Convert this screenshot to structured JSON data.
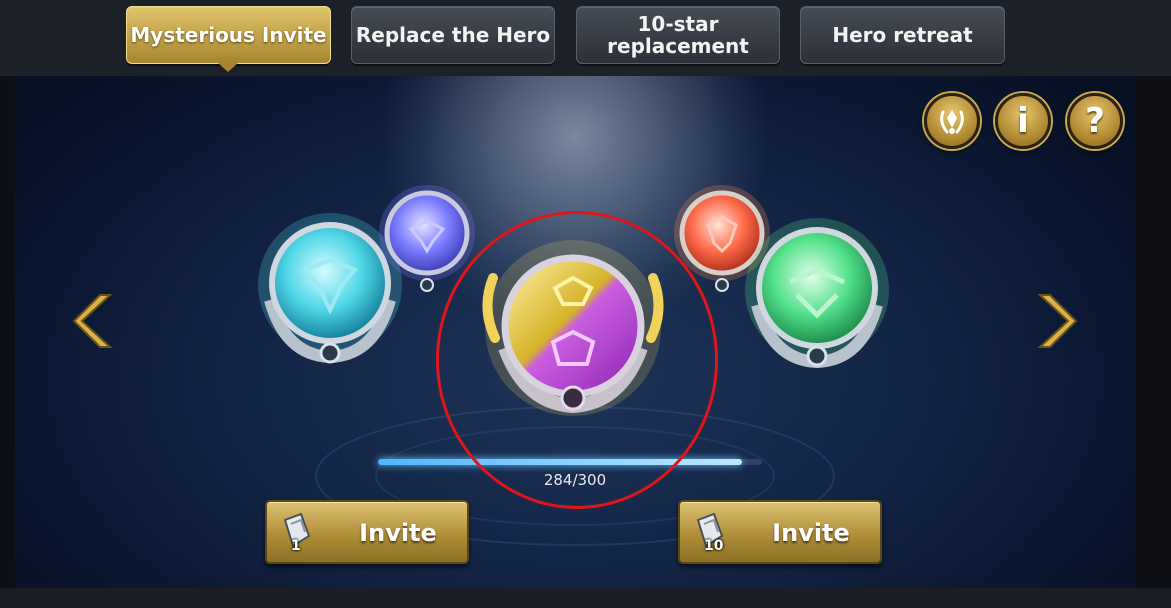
{
  "tabs": [
    {
      "label": "Mysterious Invite",
      "active": true
    },
    {
      "label": "Replace the Hero",
      "active": false
    },
    {
      "label": "10-star\nreplacement",
      "active": false
    },
    {
      "label": "Hero retreat",
      "active": false
    }
  ],
  "top_buttons": {
    "laurel": {
      "icon": "laurel-crest-icon"
    },
    "info": {
      "glyph": "i",
      "icon": "info-icon"
    },
    "help": {
      "glyph": "?",
      "icon": "question-icon"
    }
  },
  "orbs": [
    {
      "name": "cyan",
      "color": "#4fd6e6"
    },
    {
      "name": "violet",
      "color": "#7b7bff"
    },
    {
      "name": "gold-pink-featured",
      "colors": [
        "#e5c73a",
        "#d457e6"
      ]
    },
    {
      "name": "red-orange",
      "color": "#ff6a4a"
    },
    {
      "name": "green",
      "color": "#52e08a"
    }
  ],
  "progress": {
    "current": 284,
    "max": 300,
    "text": "284/300"
  },
  "invite_buttons": [
    {
      "label": "Invite",
      "count": "1",
      "icon": "ticket-icon"
    },
    {
      "label": "Invite",
      "count": "10",
      "icon": "ticket-icon"
    }
  ],
  "colors": {
    "accent_gold": "#b08e38",
    "highlight_red": "#e0141b",
    "panel_blue": "#132546"
  }
}
